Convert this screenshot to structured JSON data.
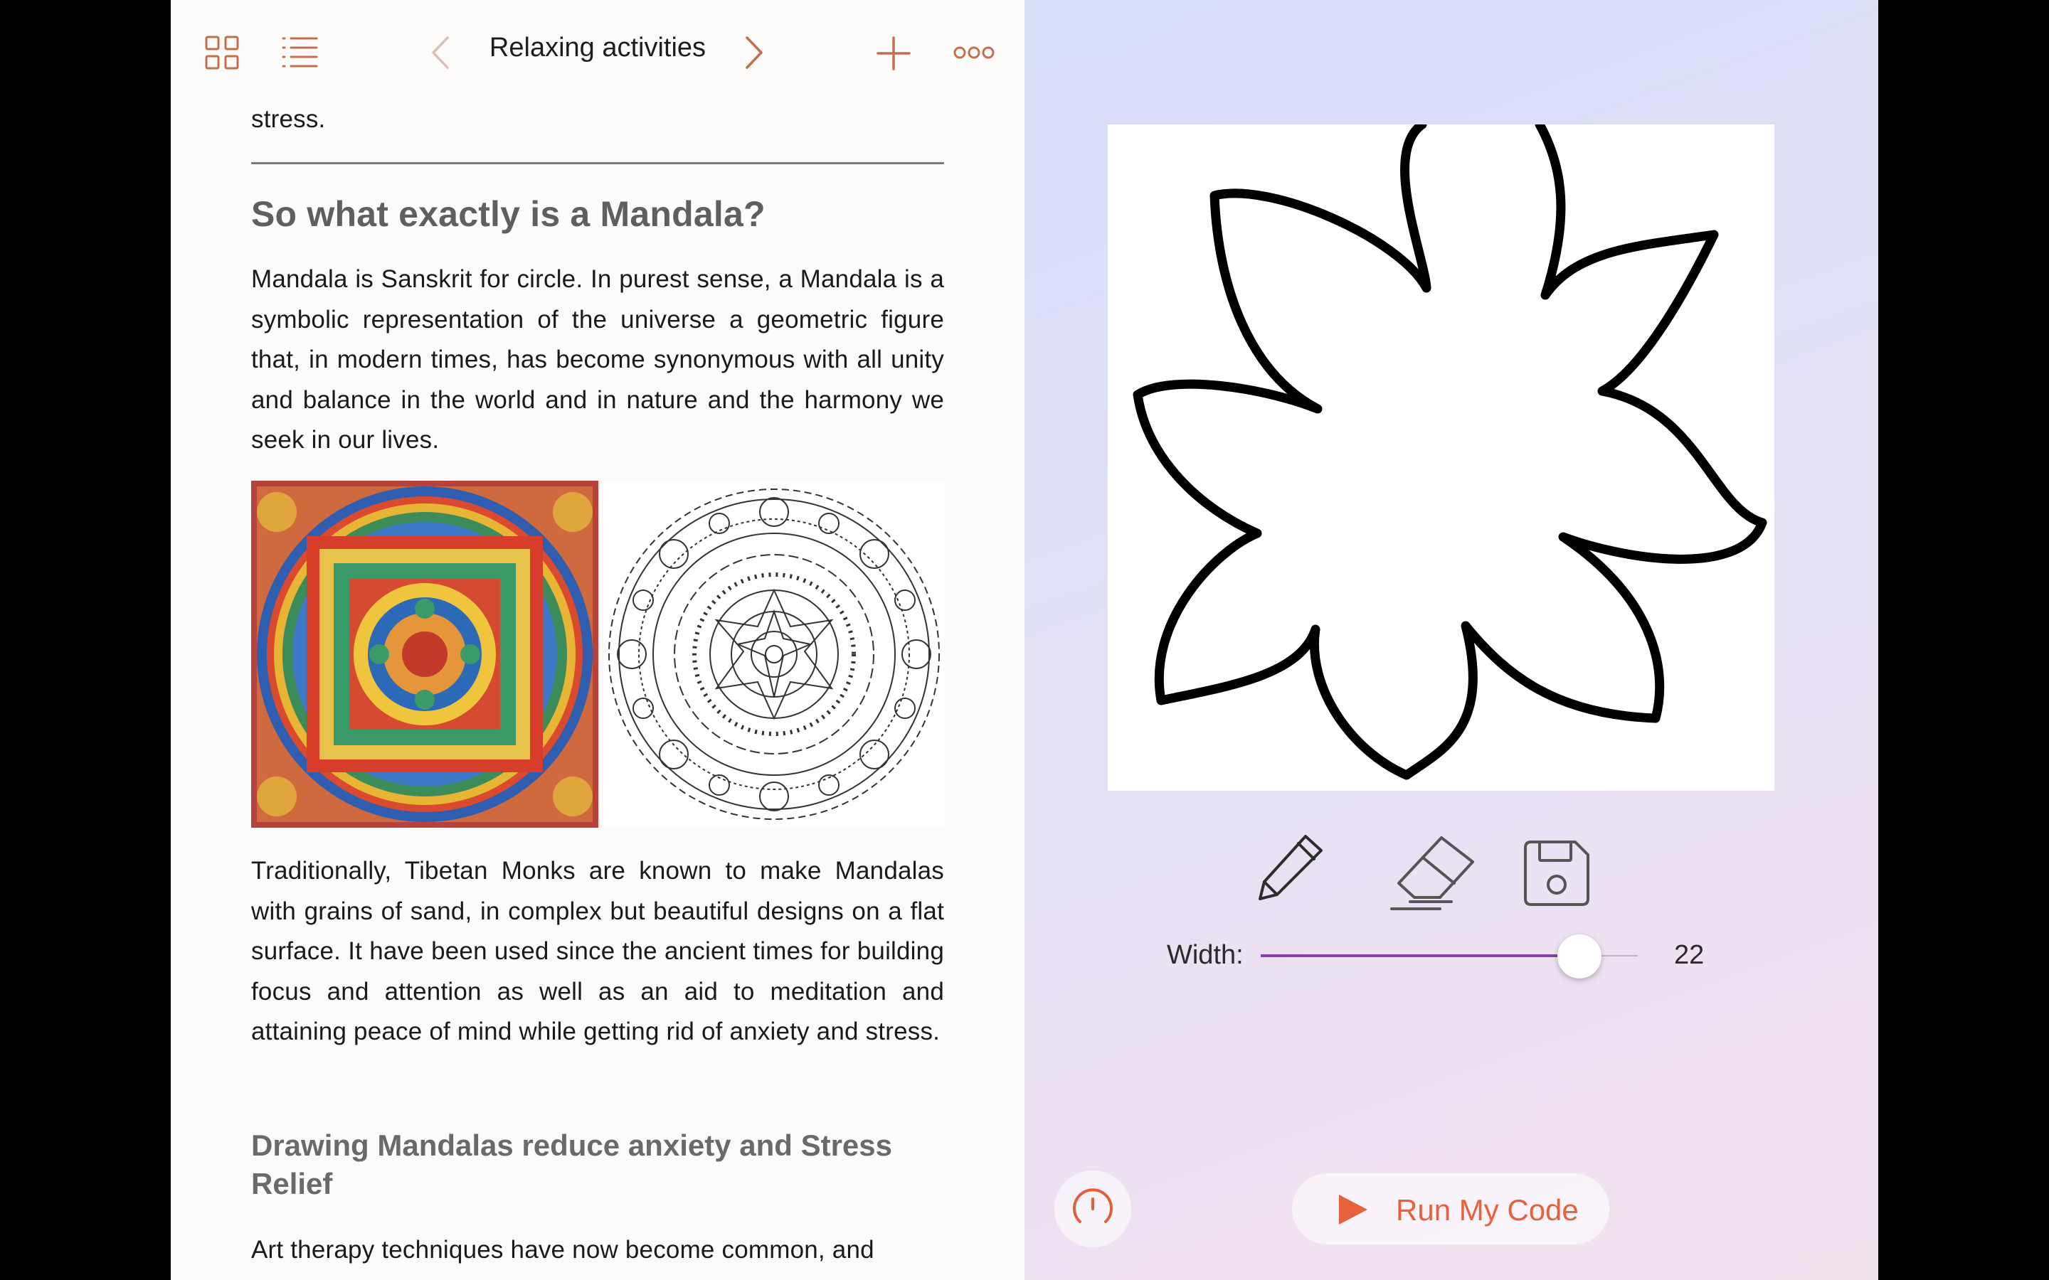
{
  "toolbar": {
    "title": "Relaxing activities",
    "grid_icon": "grid-icon",
    "list_icon": "list-icon",
    "prev_icon": "chevron-left-icon",
    "next_icon": "chevron-right-icon",
    "add_icon": "plus-icon",
    "more_icon": "more-icon",
    "accent_color": "#c1704f"
  },
  "article": {
    "fragment": "stress.",
    "heading_1": "So what exactly is a Mandala?",
    "para_1": "Mandala is Sanskrit for circle. In purest sense, a Mandala is a symbolic representation of the universe a geometric figure that, in modern times, has become synonymous with all unity and balance in the world and in nature and the harmony we seek in our lives.",
    "para_2": "Traditionally, Tibetan Monks are known to make Mandalas with grains of sand, in complex but beautiful designs on a flat surface. It have been used since the ancient times for building focus and attention as well as an aid to meditation and attaining peace of mind while getting rid of anxiety and stress.",
    "heading_2": "Drawing Mandalas reduce anxiety and Stress Relief",
    "para_3": "Art therapy techniques have now become common, and",
    "images": [
      "tibetan-mandala-painting",
      "mandala-line-art"
    ]
  },
  "drawing": {
    "tools": [
      "pencil-icon",
      "eraser-icon",
      "save-icon"
    ],
    "width_label": "Width:",
    "width_value": "22",
    "slider_fraction": 0.845,
    "slider_color": "#8a3fb0",
    "stroke_color": "#000000"
  },
  "footer": {
    "gauge_icon": "gauge-icon",
    "run_label": "Run My Code",
    "run_icon": "play-icon",
    "run_color": "#e8613d"
  }
}
